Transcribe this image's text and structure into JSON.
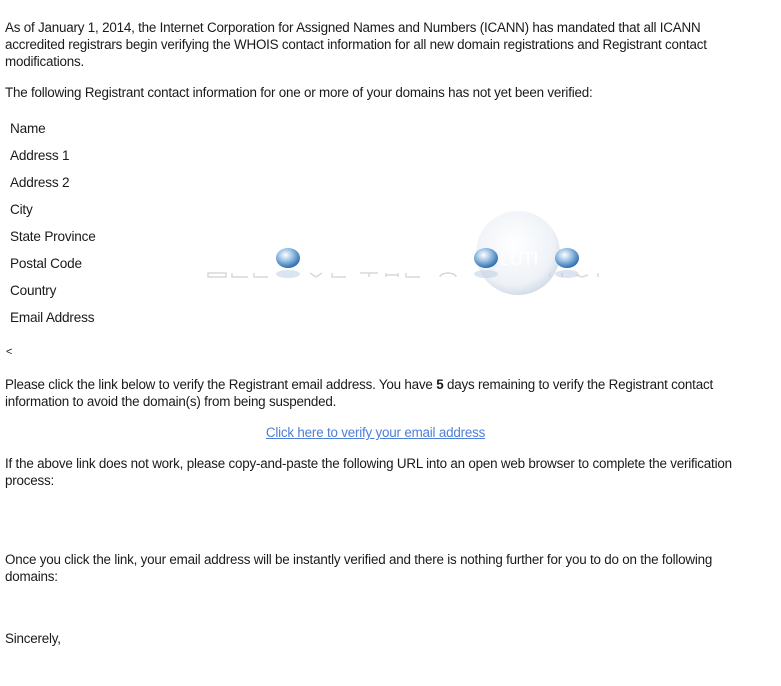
{
  "email": {
    "intro": "As of January 1, 2014, the Internet Corporation for Assigned Names and Numbers (ICANN) has mandated that all ICANN accredited registrars begin verifying the WHOIS contact information for all new domain registrations and Registrant contact modifications.",
    "unverified_notice": "The following Registrant contact information for one or more of your domains has not yet been verified:",
    "fields": [
      "Name",
      "Address 1",
      "Address 2",
      "City",
      "State Province",
      "Postal Code",
      "Country",
      "Email Address"
    ],
    "stray_char": "<",
    "verify_instructions": {
      "before": "Please click the link below to verify the Registrant email address. You have ",
      "days": "5",
      "after": " days remaining to verify the Registrant contact information to avoid the domain(s) from being suspended."
    },
    "verify_link": "Click here to verify your email address",
    "fallback_text": "If the above link does not work, please copy-and-paste the following URL into an open web browser to complete the verification process:",
    "after_click_text": "Once you click the link, your email address will be instantly verified and there is nothing further for you to do on the following domains:",
    "signoff": "Sincerely,"
  },
  "colors": {
    "link": "#4f7fd8"
  },
  "watermark": {
    "icon": "bubble-logo-watermark"
  }
}
